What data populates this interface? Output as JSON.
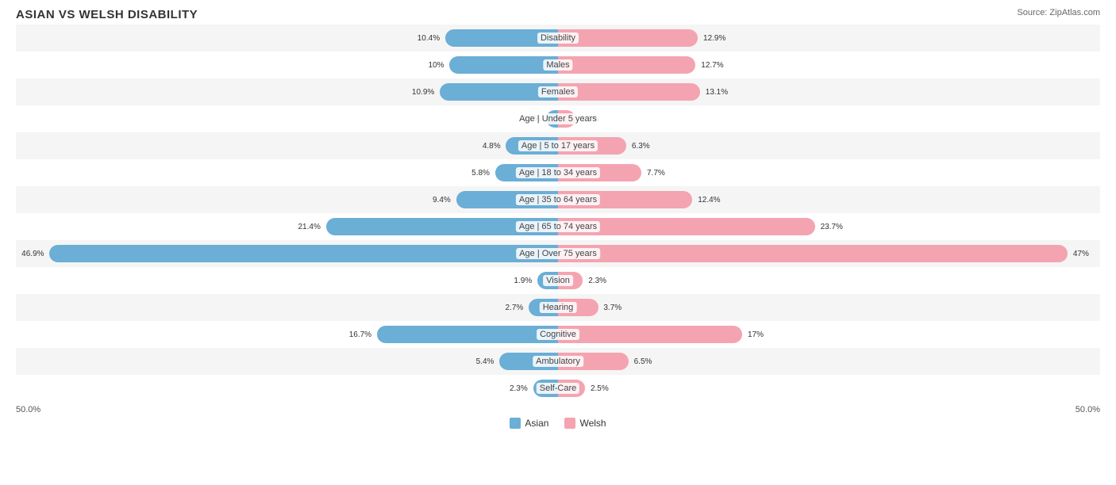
{
  "title": "ASIAN VS WELSH DISABILITY",
  "source": "Source: ZipAtlas.com",
  "chart": {
    "center_pct": 50,
    "max_pct": 50,
    "rows": [
      {
        "label": "Disability",
        "asian": 10.4,
        "welsh": 12.9
      },
      {
        "label": "Males",
        "asian": 10.0,
        "welsh": 12.7
      },
      {
        "label": "Females",
        "asian": 10.9,
        "welsh": 13.1
      },
      {
        "label": "Age | Under 5 years",
        "asian": 1.1,
        "welsh": 1.6
      },
      {
        "label": "Age | 5 to 17 years",
        "asian": 4.8,
        "welsh": 6.3
      },
      {
        "label": "Age | 18 to 34 years",
        "asian": 5.8,
        "welsh": 7.7
      },
      {
        "label": "Age | 35 to 64 years",
        "asian": 9.4,
        "welsh": 12.4
      },
      {
        "label": "Age | 65 to 74 years",
        "asian": 21.4,
        "welsh": 23.7
      },
      {
        "label": "Age | Over 75 years",
        "asian": 46.9,
        "welsh": 47.0
      },
      {
        "label": "Vision",
        "asian": 1.9,
        "welsh": 2.3
      },
      {
        "label": "Hearing",
        "asian": 2.7,
        "welsh": 3.7
      },
      {
        "label": "Cognitive",
        "asian": 16.7,
        "welsh": 17.0
      },
      {
        "label": "Ambulatory",
        "asian": 5.4,
        "welsh": 6.5
      },
      {
        "label": "Self-Care",
        "asian": 2.3,
        "welsh": 2.5
      }
    ],
    "bottom_left": "50.0%",
    "bottom_right": "50.0%"
  },
  "legend": {
    "asian_label": "Asian",
    "welsh_label": "Welsh",
    "asian_color": "#6baed6",
    "welsh_color": "#f4a4b0"
  }
}
